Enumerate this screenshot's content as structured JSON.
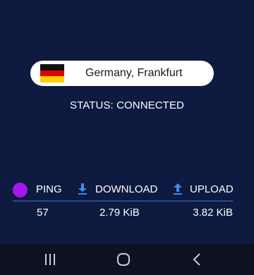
{
  "server": {
    "flag_icon": "germany-flag-icon",
    "flag_colors": [
      "#111111",
      "#dd0000",
      "#ffce00"
    ],
    "label": "Germany, Frankfurt"
  },
  "status": {
    "text": "STATUS: CONNECTED"
  },
  "stats": {
    "ping": {
      "indicator_color": "#a516ec",
      "label": "PING",
      "value": "57"
    },
    "download": {
      "icon": "download-arrow-icon",
      "label": "DOWNLOAD",
      "value": "2.79 KiB"
    },
    "upload": {
      "icon": "upload-arrow-icon",
      "label": "UPLOAD",
      "value": "3.82 KiB"
    }
  },
  "theme": {
    "background": "#0e1a3f",
    "accent": "#3b8df0",
    "divider": "#1f4e8f"
  },
  "navigation": {
    "buttons": [
      "recent-apps-icon",
      "home-icon",
      "back-icon"
    ]
  }
}
